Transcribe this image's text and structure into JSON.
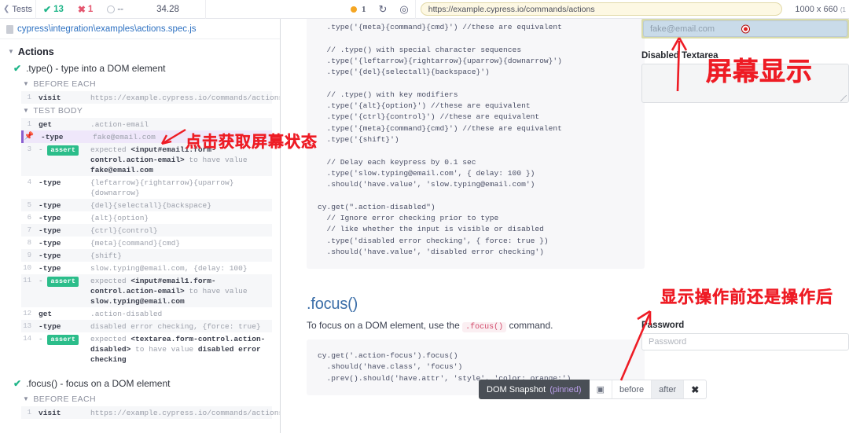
{
  "toolbar": {
    "back_label": "Tests",
    "back_icon": "chevron-left-icon",
    "passed_count": "13",
    "failed_count": "1",
    "pending_count": "--",
    "duration": "34.28",
    "indicator_icon": "orange-dot-icon",
    "indicator_label": "1",
    "reload_icon": "reload-icon",
    "selector_icon": "selector-playground-icon",
    "url": "https://example.cypress.io/commands/actions",
    "viewport_size": "1000 x 660",
    "viewport_scale": "(1"
  },
  "sidebar": {
    "spec_file": "cypress\\integration\\examples\\actions.spec.js",
    "file_icon": "file-icon",
    "suite": "Actions",
    "tests": [
      {
        "title": ".type() - type into a DOM element",
        "status_icon": "check-icon",
        "hooks": [
          {
            "label": "BEFORE EACH",
            "commands": [
              {
                "num": "1",
                "name": "visit",
                "message": "https://example.cypress.io/commands/actions",
                "type": "normal"
              }
            ]
          },
          {
            "label": "TEST BODY",
            "commands": [
              {
                "num": "1",
                "name": "get",
                "message": ".action-email",
                "type": "normal"
              },
              {
                "num": "2",
                "name": "-type",
                "message": "fake@email.com",
                "type": "pinned"
              },
              {
                "num": "3",
                "name": "assert",
                "message_pre": "expected ",
                "element": "<input#email1.form-control.action-email>",
                "message_mid": " to have value ",
                "value": "fake@email.com",
                "type": "assert"
              },
              {
                "num": "4",
                "name": "-type",
                "message": "{leftarrow}{rightarrow}{uparrow}{downarrow}",
                "type": "normal"
              },
              {
                "num": "5",
                "name": "-type",
                "message": "{del}{selectall}{backspace}",
                "type": "normal"
              },
              {
                "num": "6",
                "name": "-type",
                "message": "{alt}{option}",
                "type": "normal"
              },
              {
                "num": "7",
                "name": "-type",
                "message": "{ctrl}{control}",
                "type": "normal"
              },
              {
                "num": "8",
                "name": "-type",
                "message": "{meta}{command}{cmd}",
                "type": "normal"
              },
              {
                "num": "9",
                "name": "-type",
                "message": "{shift}",
                "type": "normal"
              },
              {
                "num": "10",
                "name": "-type",
                "message": "slow.typing@email.com, {delay: 100}",
                "type": "normal"
              },
              {
                "num": "11",
                "name": "assert",
                "message_pre": "expected ",
                "element": "<input#email1.form-control.action-email>",
                "message_mid": " to have value ",
                "value": "slow.typing@email.com",
                "type": "assert"
              },
              {
                "num": "12",
                "name": "get",
                "message": ".action-disabled",
                "type": "normal"
              },
              {
                "num": "13",
                "name": "-type",
                "message": "disabled error checking, {force: true}",
                "type": "normal"
              },
              {
                "num": "14",
                "name": "assert",
                "message_pre": "expected ",
                "element": "<textarea.form-control.action-disabled>",
                "message_mid": " to have value ",
                "value": "disabled error checking",
                "type": "assert"
              }
            ]
          }
        ]
      },
      {
        "title": ".focus() - focus on a DOM element",
        "status_icon": "check-icon",
        "hooks": [
          {
            "label": "BEFORE EACH",
            "commands": [
              {
                "num": "1",
                "name": "visit",
                "message": "https://example.cypress.io/commands/actions",
                "type": "normal"
              }
            ]
          }
        ]
      }
    ],
    "assert_badge_label": "assert",
    "pin_icon": "pin-icon"
  },
  "main": {
    "code_top": "  .type('{meta}{command}{cmd}') //these are equivalent\n\n  // .type() with special character sequences\n  .type('{leftarrow}{rightarrow}{uparrow}{downarrow}')\n  .type('{del}{selectall}{backspace}')\n\n  // .type() with key modifiers\n  .type('{alt}{option}') //these are equivalent\n  .type('{ctrl}{control}') //these are equivalent\n  .type('{meta}{command}{cmd}') //these are equivalent\n  .type('{shift}')\n\n  // Delay each keypress by 0.1 sec\n  .type('slow.typing@email.com', { delay: 100 })\n  .should('have.value', 'slow.typing@email.com')\n\ncy.get(\".action-disabled\")\n  // Ignore error checking prior to type\n  // like whether the input is visible or disabled\n  .type('disabled error checking', { force: true })\n  .should('have.value', 'disabled error checking')",
    "focus_title": ".focus()",
    "focus_desc_pre": "To focus on a DOM element, use the ",
    "focus_desc_code": ".focus()",
    "focus_desc_post": " command.",
    "focus_code": "cy.get('.action-focus').focus()\n  .should('have.class', 'focus')\n  .prev().should('have.attr', 'style', 'color: orange;')"
  },
  "form": {
    "email_value": "fake@email.com",
    "click_marker_icon": "click-marker-icon",
    "textarea_label": "Disabled Textarea",
    "password_label": "Password",
    "password_placeholder": "Password"
  },
  "snapshot_bar": {
    "title": "DOM Snapshot",
    "state": "(pinned)",
    "image_icon": "snapshot-image-icon",
    "before_label": "before",
    "after_label": "after",
    "close_icon": "close-icon"
  },
  "annotations": {
    "click_state": "点击获取屏幕状态",
    "screen_display": "屏幕显示",
    "before_after": "显示操作前还是操作后",
    "color": "#ee1c25"
  }
}
